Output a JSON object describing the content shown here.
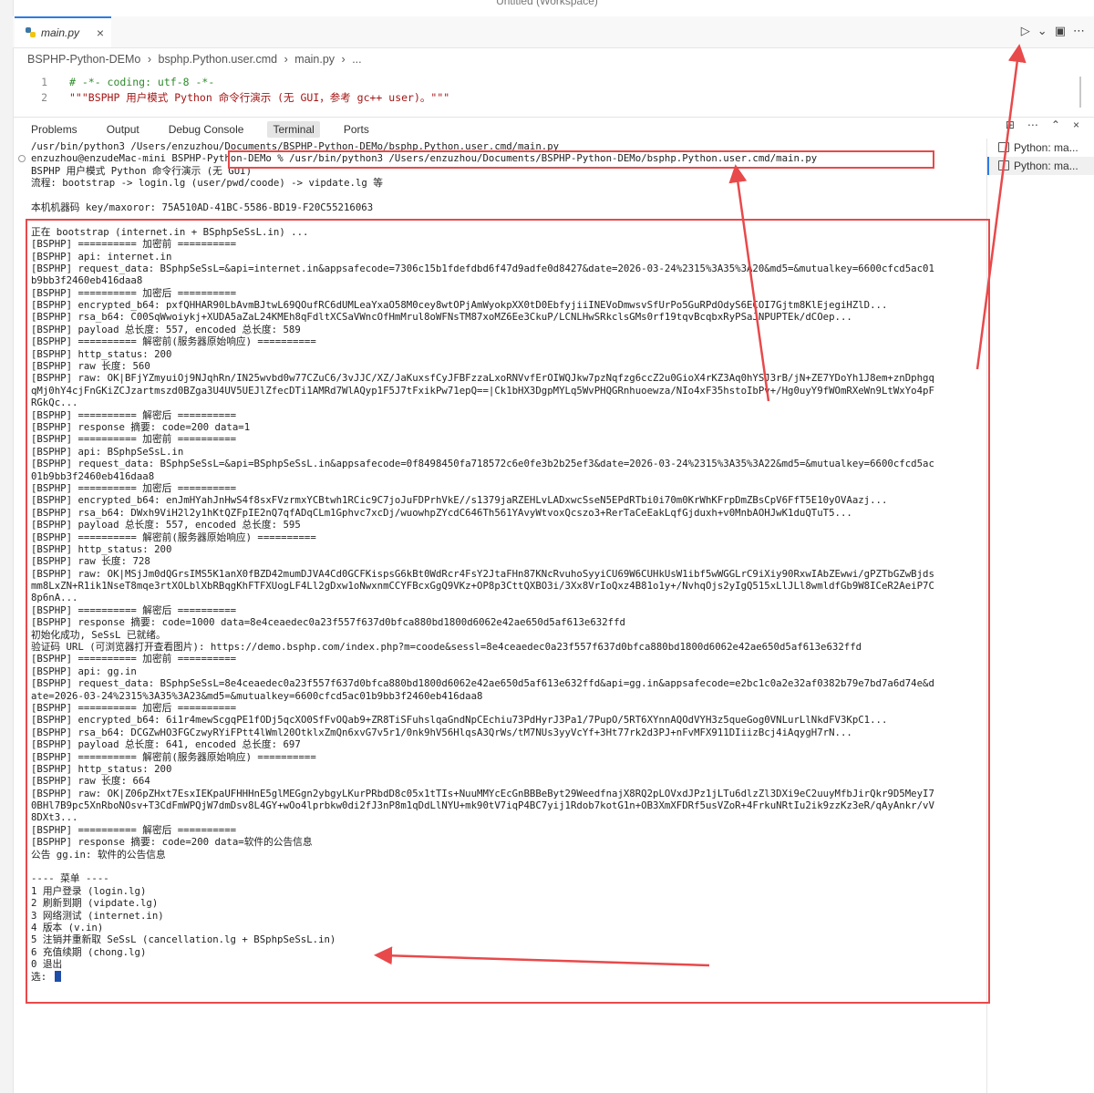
{
  "window": {
    "title": "Untitled (Workspace)"
  },
  "tabs": [
    {
      "label": "main.py",
      "close": "×"
    }
  ],
  "editor_actions": [
    "▷",
    "⌄",
    "▣",
    "⋯"
  ],
  "breadcrumb": [
    "BSPHP-Python-DEMo",
    "›",
    "bsphp.Python.user.cmd",
    "›",
    "main.py",
    "›",
    "..."
  ],
  "code": [
    {
      "num": "1",
      "text": "# -*- coding: utf-8 -*-",
      "kind": "comment"
    },
    {
      "num": "2",
      "text": "\"\"\"BSPHP 用户模式 Python 命令行演示 (无 GUI，参考 gc++ user)。\"\"\"",
      "kind": "string"
    }
  ],
  "panel": {
    "tabs": [
      "Problems",
      "Output",
      "Debug Console",
      "Terminal",
      "Ports"
    ],
    "active_tab": "Terminal",
    "actions": [
      "⊞",
      "⋯",
      "⌃",
      "×"
    ]
  },
  "terminal_list": [
    "Python: ma...",
    "Python: ma..."
  ],
  "terminal_lines": [
    "/usr/bin/python3 /Users/enzuzhou/Documents/BSPHP-Python-DEMo/bsphp.Python.user.cmd/main.py",
    "enzuzhou@enzudeMac-mini BSPHP-Python-DEMo % /usr/bin/python3 /Users/enzuzhou/Documents/BSPHP-Python-DEMo/bsphp.Python.user.cmd/main.py",
    "BSPHP 用户模式 Python 命令行演示 (无 GUI)",
    "流程: bootstrap -> login.lg (user/pwd/coode) -> vipdate.lg 等",
    "",
    "本机机器码 key/maxoror: 75A510AD-41BC-5586-BD19-F20C55216063",
    "",
    "正在 bootstrap (internet.in + BSphpSeSsL.in) ...",
    "[BSPHP] ========== 加密前 ==========",
    "[BSPHP] api: internet.in",
    "[BSPHP] request_data: BSphpSeSsL=&api=internet.in&appsafecode=7306c15b1fdefdbd6f47d9adfe0d8427&date=2026-03-24%2315%3A35%3A20&md5=&mutualkey=6600cfcd5ac01",
    "b9bb3f2460eb416daa8",
    "[BSPHP] ========== 加密后 ==========",
    "[BSPHP] encrypted_b64: pxfQHHAR90LbAvmBJtwL69QOufRC6dUMLeaYxaO58M0cey8wtOPjAmWyokpXX0tD0EbfyjiiINEVoDmwsvSfUrPo5GuRPdOdyS6ECOI7Gjtm8KlEjegiHZlD...",
    "[BSPHP] rsa_b64: C00SqWwoiykj+XUDA5aZaL24KMEh8qFdltXCSaVWncOfHmMrul8oWFNsTM87xoMZ6Ee3CkuP/LCNLHwSRkclsGMs0rf19tqvBcqbxRyPSaJNPUPTEk/dCOep...",
    "[BSPHP] payload 总长度: 557, encoded 总长度: 589",
    "[BSPHP] ========== 解密前(服务器原始响应) ==========",
    "[BSPHP] http_status: 200",
    "[BSPHP] raw 长度: 560",
    "[BSPHP] raw: OK|BFjYZmyuiOj9NJqhRn/IN25wvbd0w77CZuC6/3vJJC/XZ/JaKuxsfCyJFBFzzaLxoRNVvfErOIWQJkw7pzNqfzg6ccZ2u0GioX4rKZ3Aq0hYSJ3rB/jN+ZE7YDoYh1J8em+znDphgq",
    "qMj0hY4cjFnGKiZCJzartmszd0BZga3U4UV5UEJlZfecDTi1AMRd7WlAQyp1F5J7tFxikPw71epQ==|Ck1bHX3DgpMYLq5WvPHQGRnhuoewza/NIo4xF35hstoIbPv+/Hg0uyY9fWOmRXeWn9LtWxYo4pF",
    "RGkQc...",
    "[BSPHP] ========== 解密后 ==========",
    "[BSPHP] response 摘要: code=200 data=1",
    "[BSPHP] ========== 加密前 ==========",
    "[BSPHP] api: BSphpSeSsL.in",
    "[BSPHP] request_data: BSphpSeSsL=&api=BSphpSeSsL.in&appsafecode=0f8498450fa718572c6e0fe3b2b25ef3&date=2026-03-24%2315%3A35%3A22&md5=&mutualkey=6600cfcd5ac",
    "01b9bb3f2460eb416daa8",
    "[BSPHP] ========== 加密后 ==========",
    "[BSPHP] encrypted_b64: enJmHYahJnHwS4f8sxFVzrmxYCBtwh1RCic9C7joJuFDPrhVkE//s1379jaRZEHLvLADxwcSseN5EPdRTbi0i70m0KrWhKFrpDmZBsCpV6FfT5E10yOVAazj...",
    "[BSPHP] rsa_b64: DWxh9ViH2l2y1hKtQZFpIE2nQ7qfADqCLm1Gphvc7xcDj/wuowhpZYcdC646Th561YAvyWtvoxQcszo3+RerTaCeEakLqfGjduxh+v0MnbAOHJwK1duQTuT5...",
    "[BSPHP] payload 总长度: 557, encoded 总长度: 595",
    "[BSPHP] ========== 解密前(服务器原始响应) ==========",
    "[BSPHP] http_status: 200",
    "[BSPHP] raw 长度: 728",
    "[BSPHP] raw: OK|MSjJm0dQGrsIMS5K1anX0fBZD42mumDJVA4Cd0GCFKispsG6kBt0WdRcr4FsY2JtaFHn87KNcRvuhoSyyiCU69W6CUHkUsW1ibf5wWGGLrC9iXiy90RxwIAbZEwwi/gPZTbGZwBjds",
    "mm8LxZN+R1ik1NseT8mqe3rtXOLblXbRBqgKhFTFXUogLF4Ll2gDxw1oNwxnmCCYFBcxGgQ9VKz+OP8p3CttQXBO3i/3Xx8VrIoQxz4B81o1y+/NvhqOjs2yIgQ515xLlJLl8wmldfGb9W8ICeR2AeiP7C",
    "8p6nA...",
    "[BSPHP] ========== 解密后 ==========",
    "[BSPHP] response 摘要: code=1000 data=8e4ceaedec0a23f557f637d0bfca880bd1800d6062e42ae650d5af613e632ffd",
    "初始化成功, SeSsL 已就绪。",
    "验证码 URL (可浏览器打开查看图片): https://demo.bsphp.com/index.php?m=coode&sessl=8e4ceaedec0a23f557f637d0bfca880bd1800d6062e42ae650d5af613e632ffd",
    "[BSPHP] ========== 加密前 ==========",
    "[BSPHP] api: gg.in",
    "[BSPHP] request_data: BSphpSeSsL=8e4ceaedec0a23f557f637d0bfca880bd1800d6062e42ae650d5af613e632ffd&api=gg.in&appsafecode=e2bc1c0a2e32af0382b79e7bd7a6d74e&d",
    "ate=2026-03-24%2315%3A35%3A23&md5=&mutualkey=6600cfcd5ac01b9bb3f2460eb416daa8",
    "[BSPHP] ========== 加密后 ==========",
    "[BSPHP] encrypted_b64: 6i1r4mewScgqPE1fODj5qcXO0SfFvOQab9+ZR8TiSFuhslqaGndNpCEchiu73PdHyrJ3Pa1/7PupO/5RT6XYnnAQOdVYH3z5queGog0VNLurLlNkdFV3KpC1...",
    "[BSPHP] rsa_b64: DCGZwHO3FGCzwyRYiFPtt4lWml20OtklxZmQn6xvG7v5r1/0nk9hV56HlqsA3QrWs/tM7NUs3yyVcYf+3Ht77rk2d3PJ+nFvMFX911DIiizBcj4iAqygH7rN...",
    "[BSPHP] payload 总长度: 641, encoded 总长度: 697",
    "[BSPHP] ========== 解密前(服务器原始响应) ==========",
    "[BSPHP] http_status: 200",
    "[BSPHP] raw 长度: 664",
    "[BSPHP] raw: OK|Z06pZHxt7EsxIEKpaUFHHHnE5glMEGgn2ybgyLKurPRbdD8c05x1tTIs+NuuMMYcEcGnBBBeByt29WeedfnajX8RQ2pLOVxdJPz1jLTu6dlzZl3DXi9eC2uuyMfbJirQkr9D5MeyI7",
    "0BHl7B9pc5XnRboNOsv+T3CdFmWPQjW7dmDsv8L4GY+wOo4lprbkw0di2fJ3nP8m1qDdLlNYU+mk90tV7iqP4BC7yij1Rdob7kotG1n+OB3XmXFDRf5usVZoR+4FrkuNRtIu2ik9zzKz3eR/qAyAnkr/vV",
    "8DXt3...",
    "[BSPHP] ========== 解密后 ==========",
    "[BSPHP] response 摘要: code=200 data=软件的公告信息",
    "公告 gg.in: 软件的公告信息",
    "",
    "---- 菜单 ----",
    "1 用户登录 (login.lg)",
    "2 刷新到期 (vipdate.lg)",
    "3 网络测试 (internet.in)",
    "4 版本 (v.in)",
    "5 注销并重新取 SeSsL (cancellation.lg + BSphpSeSsL.in)",
    "6 充值续期 (chong.lg)",
    "0 退出",
    "选: "
  ],
  "colors": {
    "accent": "#2d7be5",
    "annotation_red": "#e8494b",
    "comment": "#308a2c",
    "string": "#a31515"
  }
}
